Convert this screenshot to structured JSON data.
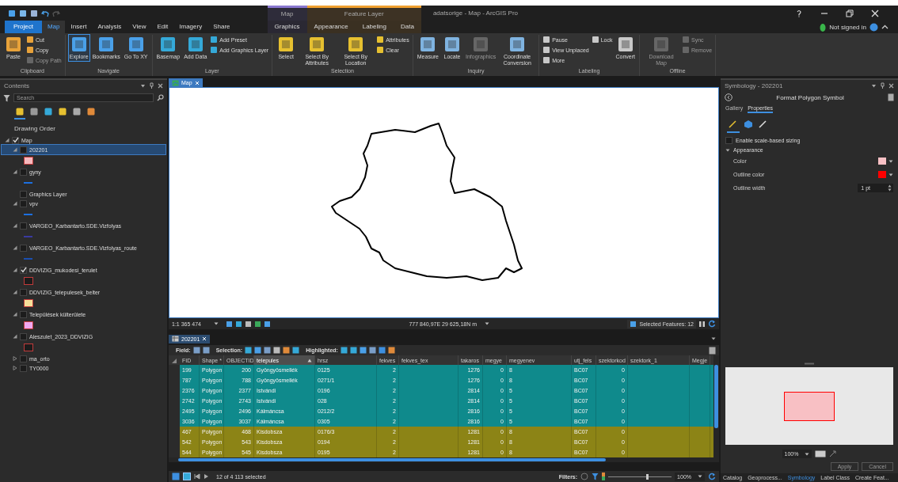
{
  "window": {
    "title": "adatsorige - Map - ArcGIS Pro"
  },
  "account": {
    "label": "Not signed in"
  },
  "ribbon": {
    "tabs": [
      {
        "label": "Project",
        "kind": "backstage",
        "selected": false
      },
      {
        "label": "Map",
        "kind": "normal",
        "selected": true
      },
      {
        "label": "Insert",
        "kind": "normal",
        "selected": false
      },
      {
        "label": "Analysis",
        "kind": "normal",
        "selected": false
      },
      {
        "label": "View",
        "kind": "normal",
        "selected": false
      },
      {
        "label": "Edit",
        "kind": "normal",
        "selected": false
      },
      {
        "label": "Imagery",
        "kind": "normal",
        "selected": false
      },
      {
        "label": "Share",
        "kind": "normal",
        "selected": false
      }
    ],
    "contexts": [
      {
        "label": "Map",
        "color": "#8a78d0",
        "tabs": [
          {
            "label": "Graphics",
            "selected": false
          }
        ]
      },
      {
        "label": "Feature Layer",
        "color": "#f0a030",
        "tabs": [
          {
            "label": "Appearance",
            "selected": false
          },
          {
            "label": "Labeling",
            "selected": false
          },
          {
            "label": "Data",
            "selected": false
          }
        ]
      }
    ],
    "groups": [
      {
        "label": "Clipboard",
        "buttons": [
          {
            "label": "Paste",
            "kind": "large",
            "disabled": false,
            "selected": false
          },
          {
            "label": "Cut",
            "kind": "small",
            "disabled": false,
            "selected": false
          },
          {
            "label": "Copy",
            "kind": "small",
            "disabled": false,
            "selected": false
          },
          {
            "label": "Copy Path",
            "kind": "small",
            "disabled": true,
            "selected": false
          }
        ]
      },
      {
        "label": "Navigate",
        "buttons": [
          {
            "label": "Explore",
            "kind": "large",
            "disabled": false,
            "selected": true
          },
          {
            "label": "Bookmarks",
            "kind": "large",
            "disabled": false,
            "selected": false
          },
          {
            "label": "Go To XY",
            "kind": "large",
            "disabled": false,
            "selected": false
          }
        ]
      },
      {
        "label": "Layer",
        "buttons": [
          {
            "label": "Basemap",
            "kind": "large",
            "disabled": false,
            "selected": false
          },
          {
            "label": "Add Data",
            "kind": "large",
            "disabled": false,
            "selected": false
          },
          {
            "label": "Add Preset",
            "kind": "small",
            "disabled": false,
            "selected": false
          },
          {
            "label": "Add Graphics Layer",
            "kind": "small",
            "disabled": false,
            "selected": false
          }
        ]
      },
      {
        "label": "Selection",
        "buttons": [
          {
            "label": "Select",
            "kind": "large",
            "disabled": false,
            "selected": false
          },
          {
            "label": "Select By Attributes",
            "kind": "large",
            "disabled": false,
            "selected": false
          },
          {
            "label": "Select By Location",
            "kind": "large",
            "disabled": false,
            "selected": false
          },
          {
            "label": "Attributes",
            "kind": "small",
            "disabled": false,
            "selected": false
          },
          {
            "label": "Clear",
            "kind": "small",
            "disabled": false,
            "selected": false
          }
        ]
      },
      {
        "label": "Inquiry",
        "buttons": [
          {
            "label": "Measure",
            "kind": "large",
            "disabled": false,
            "selected": false
          },
          {
            "label": "Locate",
            "kind": "large",
            "disabled": false,
            "selected": false
          },
          {
            "label": "Infographics",
            "kind": "large",
            "disabled": true,
            "selected": false
          },
          {
            "label": "Coordinate Conversion",
            "kind": "large",
            "disabled": false,
            "selected": false
          }
        ]
      },
      {
        "label": "Labeling",
        "buttons": [
          {
            "label": "Pause",
            "kind": "small",
            "disabled": false,
            "selected": false
          },
          {
            "label": "View Unplaced",
            "kind": "small",
            "disabled": false,
            "selected": false
          },
          {
            "label": "More",
            "kind": "small",
            "disabled": false,
            "selected": false
          },
          {
            "label": "Lock",
            "kind": "small",
            "disabled": false,
            "selected": false
          },
          {
            "label": "Convert",
            "kind": "large",
            "disabled": false,
            "selected": false
          }
        ]
      },
      {
        "label": "Offline",
        "buttons": [
          {
            "label": "Download Map",
            "kind": "large",
            "disabled": true,
            "selected": false
          },
          {
            "label": "Sync",
            "kind": "small",
            "disabled": true,
            "selected": false
          },
          {
            "label": "Remove",
            "kind": "small",
            "disabled": true,
            "selected": false
          }
        ]
      }
    ]
  },
  "contents": {
    "title": "Contents",
    "search": {
      "placeholder": "Search"
    },
    "views": [
      {
        "selected": true
      },
      {
        "selected": false
      },
      {
        "selected": false
      },
      {
        "selected": false
      },
      {
        "selected": false
      },
      {
        "selected": false
      }
    ],
    "heading": "Drawing Order",
    "tree": [
      {
        "label": "Map",
        "checked": true,
        "expanded": true,
        "selected": false,
        "children": [
          {
            "label": "202201",
            "checked": false,
            "expanded": true,
            "selected": true,
            "symbol": {
              "kind": "fill",
              "color": "#f6b9bd"
            }
          },
          {
            "label": "gyny",
            "checked": false,
            "expanded": true,
            "selected": false,
            "symbol": {
              "kind": "line",
              "color": "#1c6fe0"
            }
          },
          {
            "label": "Graphics Layer",
            "checked": false,
            "selected": false
          },
          {
            "label": "vpv",
            "checked": false,
            "expanded": true,
            "selected": false,
            "symbol": {
              "kind": "line",
              "color": "#1c6fe0"
            }
          },
          {
            "label": "VARGEO_Karbantarto.SDE.Vizfolyas",
            "checked": false,
            "expanded": true,
            "selected": false,
            "symbol": {
              "kind": "line",
              "color": "#3a3aa0"
            }
          },
          {
            "label": "VARGEO_Karbantarto.SDE.Vizfolyas_route",
            "checked": false,
            "expanded": true,
            "selected": false,
            "symbol": {
              "kind": "line",
              "color": "#1a4fb0"
            }
          },
          {
            "label": "DDVIZIG_mukodesi_terulet",
            "checked": true,
            "expanded": true,
            "selected": false,
            "symbol": {
              "kind": "fill",
              "color": "#1c1c1c"
            }
          },
          {
            "label": "DDVIZIG_telepulesek_belter",
            "checked": false,
            "expanded": true,
            "selected": false,
            "symbol": {
              "kind": "fill",
              "color": "#f5df9a"
            }
          },
          {
            "label": "Települések külterülete",
            "checked": false,
            "expanded": true,
            "selected": false,
            "symbol": {
              "kind": "fill",
              "color": "#f0a8f0"
            }
          },
          {
            "label": "Aleszulet_2023_DDVIZIG",
            "checked": false,
            "expanded": true,
            "selected": false,
            "symbol": {
              "kind": "fill",
              "color": "#1c1c1c"
            }
          },
          {
            "label": "ma_orto",
            "checked": false,
            "expanded": false,
            "selected": false
          },
          {
            "label": "TY0000",
            "checked": false,
            "expanded": false,
            "selected": false
          }
        ]
      }
    ]
  },
  "map": {
    "tab": "Map",
    "scale": "1:1 365 474",
    "coordinates": "777 840,97E 29 625,18N m",
    "selected_features": "Selected Features: 12"
  },
  "table": {
    "tab": "202201",
    "field_label": "Field:",
    "selection_label": "Selection:",
    "highlighted_label": "Highlighted:",
    "columns": [
      {
        "label": "FID",
        "sorted": false
      },
      {
        "label": "Shape *",
        "sorted": false
      },
      {
        "label": "OBJECTID",
        "sorted": false
      },
      {
        "label": "telepules",
        "sorted": true
      },
      {
        "label": "hrsz",
        "sorted": false
      },
      {
        "label": "fekves",
        "sorted": false
      },
      {
        "label": "fekves_tex",
        "sorted": false
      },
      {
        "label": "takaros",
        "sorted": false
      },
      {
        "label": "megye",
        "sorted": false
      },
      {
        "label": "megyenev",
        "sorted": false
      },
      {
        "label": "utj_fels",
        "sorted": false
      },
      {
        "label": "szektorkod",
        "sorted": false
      },
      {
        "label": "szektork_1",
        "sorted": false
      },
      {
        "label": "Megje",
        "sorted": false
      }
    ],
    "rows": [
      {
        "highlighted": false,
        "cells": [
          "199",
          "Polygon",
          "200",
          "Gyöngyösmellék",
          "0125",
          "2",
          "",
          "1276",
          "0",
          "8",
          "BC07",
          "0",
          "",
          ""
        ]
      },
      {
        "highlighted": false,
        "cells": [
          "787",
          "Polygon",
          "788",
          "Gyöngyösmellék",
          "0271/1",
          "2",
          "",
          "1276",
          "0",
          "8",
          "BC07",
          "0",
          "",
          ""
        ]
      },
      {
        "highlighted": false,
        "cells": [
          "2376",
          "Polygon",
          "2377",
          "Istvándi",
          "0196",
          "2",
          "",
          "2814",
          "0",
          "5",
          "BC07",
          "0",
          "",
          ""
        ]
      },
      {
        "highlighted": false,
        "cells": [
          "2742",
          "Polygon",
          "2743",
          "Istvándi",
          "028",
          "2",
          "",
          "2814",
          "0",
          "5",
          "BC07",
          "0",
          "",
          ""
        ]
      },
      {
        "highlighted": false,
        "cells": [
          "2495",
          "Polygon",
          "2496",
          "Kálmáncsa",
          "0212/2",
          "2",
          "",
          "2816",
          "0",
          "5",
          "BC07",
          "0",
          "",
          ""
        ]
      },
      {
        "highlighted": false,
        "cells": [
          "3036",
          "Polygon",
          "3037",
          "Kálmáncsa",
          "0305",
          "2",
          "",
          "2816",
          "0",
          "5",
          "BC07",
          "0",
          "",
          ""
        ]
      },
      {
        "highlighted": true,
        "cells": [
          "467",
          "Polygon",
          "468",
          "Kisdobsza",
          "0176/3",
          "2",
          "",
          "1281",
          "0",
          "8",
          "BC07",
          "0",
          "",
          ""
        ]
      },
      {
        "highlighted": true,
        "cells": [
          "542",
          "Polygon",
          "543",
          "Kisdobsza",
          "0194",
          "2",
          "",
          "1281",
          "0",
          "8",
          "BC07",
          "0",
          "",
          ""
        ]
      },
      {
        "highlighted": true,
        "cells": [
          "544",
          "Polygon",
          "545",
          "Kisdobsza",
          "0195",
          "2",
          "",
          "1281",
          "0",
          "8",
          "BC07",
          "0",
          "",
          ""
        ]
      }
    ],
    "status": "12 of 4 113 selected",
    "filters_label": "Filters:",
    "zoom_slider": {
      "level": 0.6
    },
    "zoom": "100%"
  },
  "symbology": {
    "title": "Symbology - 202201",
    "heading": "Format Polygon Symbol",
    "tabs": [
      {
        "label": "Gallery",
        "selected": false
      },
      {
        "label": "Properties",
        "selected": true
      }
    ],
    "icon_tabs": [
      {
        "selected": true
      },
      {
        "selected": false
      },
      {
        "selected": false
      }
    ],
    "scale_sizing": {
      "label": "Enable scale-based sizing",
      "checked": false
    },
    "section": {
      "label": "Appearance",
      "expanded": true
    },
    "properties": [
      {
        "kind": "color",
        "label": "Color",
        "color": "#f8c0c4"
      },
      {
        "kind": "color",
        "label": "Outline color",
        "color": "#ff0000"
      },
      {
        "kind": "number",
        "label": "Outline width",
        "value": "1 pt"
      }
    ],
    "preview_zoom": "100%",
    "buttons": [
      {
        "label": "Apply",
        "disabled": true
      },
      {
        "label": "Cancel",
        "disabled": true
      }
    ]
  },
  "dock_tabs": [
    {
      "label": "Catalog",
      "selected": false
    },
    {
      "label": "Geoprocess...",
      "selected": false
    },
    {
      "label": "Symbology",
      "selected": true
    },
    {
      "label": "Label Class",
      "selected": false
    },
    {
      "label": "Create Feat...",
      "selected": false
    }
  ]
}
